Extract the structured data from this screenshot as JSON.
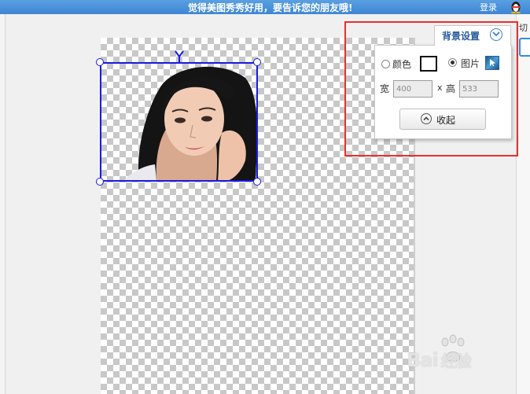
{
  "header": {
    "promo": "觉得美图秀秀好用，要告诉您的朋友哦!",
    "login": "登录",
    "qq_icon": "qq-penguin-icon"
  },
  "sidebar_right": {
    "cut_label": "切"
  },
  "bg_settings": {
    "title": "背景设置",
    "color_option": "颜色",
    "image_option": "图片",
    "selected": "image",
    "swatch_color": "#ffffff",
    "width_label": "宽",
    "width_value": "400",
    "times": "x",
    "height_label": "高",
    "height_value": "533",
    "collapse_label": "收起"
  },
  "colors": {
    "highlight": "#e53131",
    "selection": "#1a1adf",
    "header": "#3d86d3"
  },
  "watermark": {
    "brand": "Bai",
    "brand2": "经验"
  }
}
